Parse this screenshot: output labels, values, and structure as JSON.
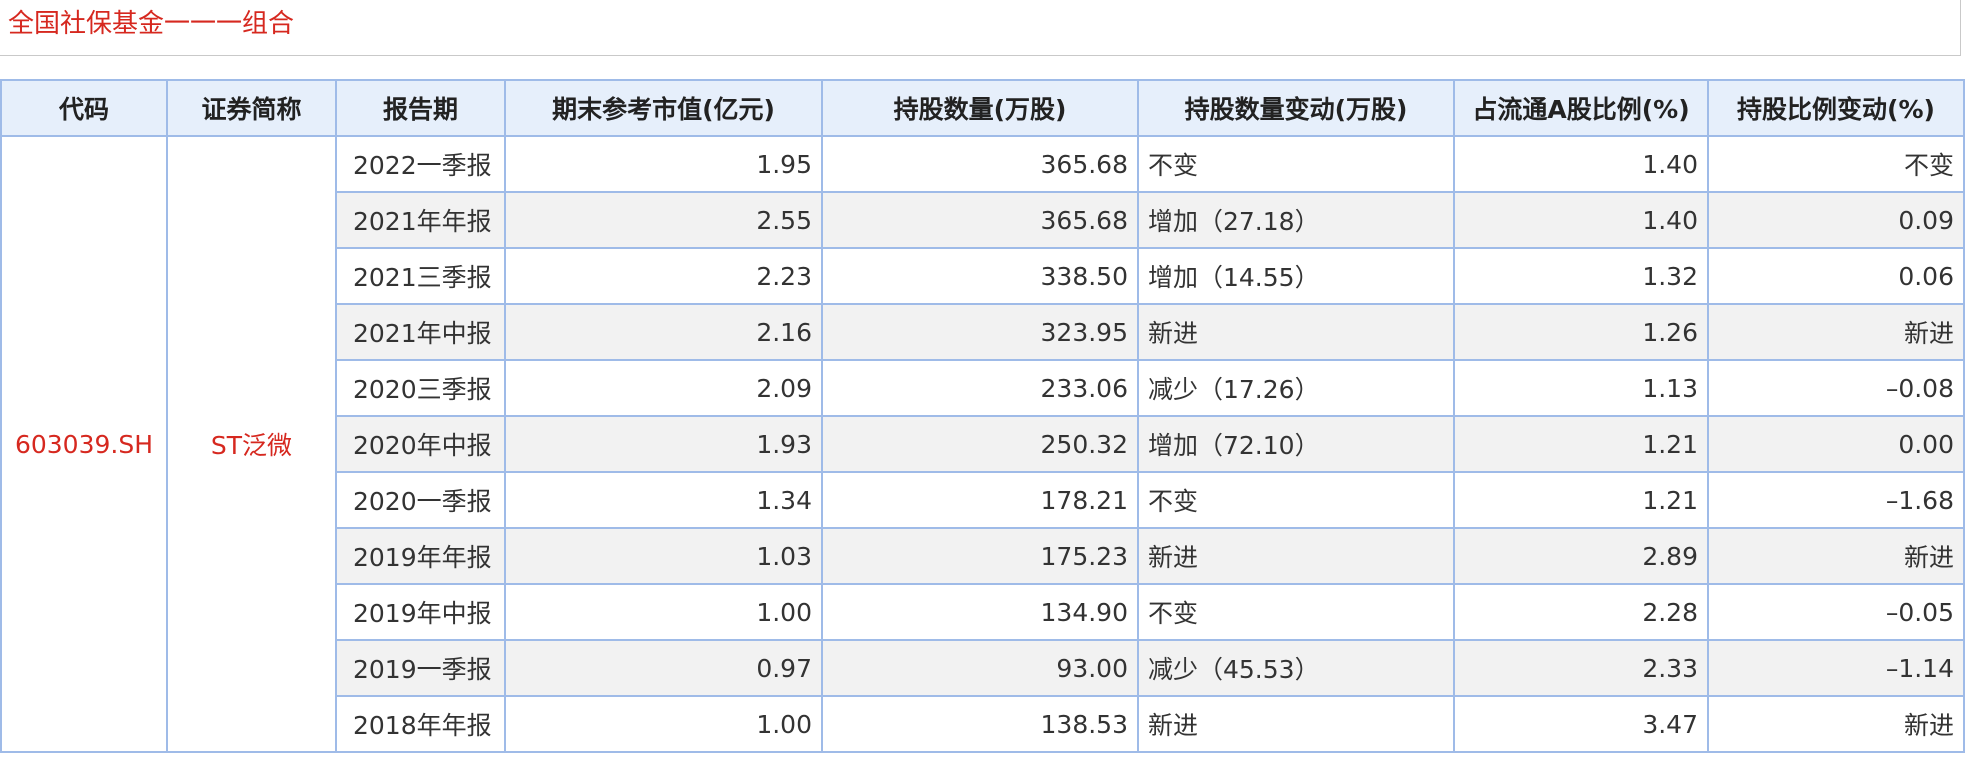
{
  "title": "全国社保基金一一一组合",
  "colors": {
    "same": "#333333",
    "increase": "#d6281f",
    "decrease": "#2a8a2a",
    "new": "#1418a8",
    "header_bg": "#e6effb",
    "border": "#9fbbe8"
  },
  "table": {
    "headers": [
      "代码",
      "证券简称",
      "报告期",
      "期末参考市值(亿元)",
      "持股数量(万股)",
      "持股数量变动(万股)",
      "占流通A股比例(%)",
      "持股比例变动(%)"
    ],
    "code": "603039.SH",
    "name": "ST泛微",
    "rows": [
      {
        "period": "2022一季报",
        "market_value": "1.95",
        "shares": "365.68",
        "share_change": "不变",
        "share_change_type": "same",
        "float_ratio": "1.40",
        "ratio_change": "不变",
        "ratio_change_type": "same"
      },
      {
        "period": "2021年年报",
        "market_value": "2.55",
        "shares": "365.68",
        "share_change": "增加（27.18）",
        "share_change_type": "inc",
        "float_ratio": "1.40",
        "ratio_change": "0.09",
        "ratio_change_type": "inc"
      },
      {
        "period": "2021三季报",
        "market_value": "2.23",
        "shares": "338.50",
        "share_change": "增加（14.55）",
        "share_change_type": "inc",
        "float_ratio": "1.32",
        "ratio_change": "0.06",
        "ratio_change_type": "inc"
      },
      {
        "period": "2021年中报",
        "market_value": "2.16",
        "shares": "323.95",
        "share_change": "新进",
        "share_change_type": "new",
        "float_ratio": "1.26",
        "ratio_change": "新进",
        "ratio_change_type": "new"
      },
      {
        "period": "2020三季报",
        "market_value": "2.09",
        "shares": "233.06",
        "share_change": "减少（17.26）",
        "share_change_type": "dec",
        "float_ratio": "1.13",
        "ratio_change": "–0.08",
        "ratio_change_type": "dec"
      },
      {
        "period": "2020年中报",
        "market_value": "1.93",
        "shares": "250.32",
        "share_change": "增加（72.10）",
        "share_change_type": "inc",
        "float_ratio": "1.21",
        "ratio_change": "0.00",
        "ratio_change_type": "same"
      },
      {
        "period": "2020一季报",
        "market_value": "1.34",
        "shares": "178.21",
        "share_change": "不变",
        "share_change_type": "same",
        "float_ratio": "1.21",
        "ratio_change": "–1.68",
        "ratio_change_type": "dec"
      },
      {
        "period": "2019年年报",
        "market_value": "1.03",
        "shares": "175.23",
        "share_change": "新进",
        "share_change_type": "new",
        "float_ratio": "2.89",
        "ratio_change": "新进",
        "ratio_change_type": "new"
      },
      {
        "period": "2019年中报",
        "market_value": "1.00",
        "shares": "134.90",
        "share_change": "不变",
        "share_change_type": "same",
        "float_ratio": "2.28",
        "ratio_change": "–0.05",
        "ratio_change_type": "dec"
      },
      {
        "period": "2019一季报",
        "market_value": "0.97",
        "shares": "93.00",
        "share_change": "减少（45.53）",
        "share_change_type": "dec",
        "float_ratio": "2.33",
        "ratio_change": "–1.14",
        "ratio_change_type": "dec"
      },
      {
        "period": "2018年年报",
        "market_value": "1.00",
        "shares": "138.53",
        "share_change": "新进",
        "share_change_type": "new",
        "float_ratio": "3.47",
        "ratio_change": "新进",
        "ratio_change_type": "new"
      }
    ]
  }
}
